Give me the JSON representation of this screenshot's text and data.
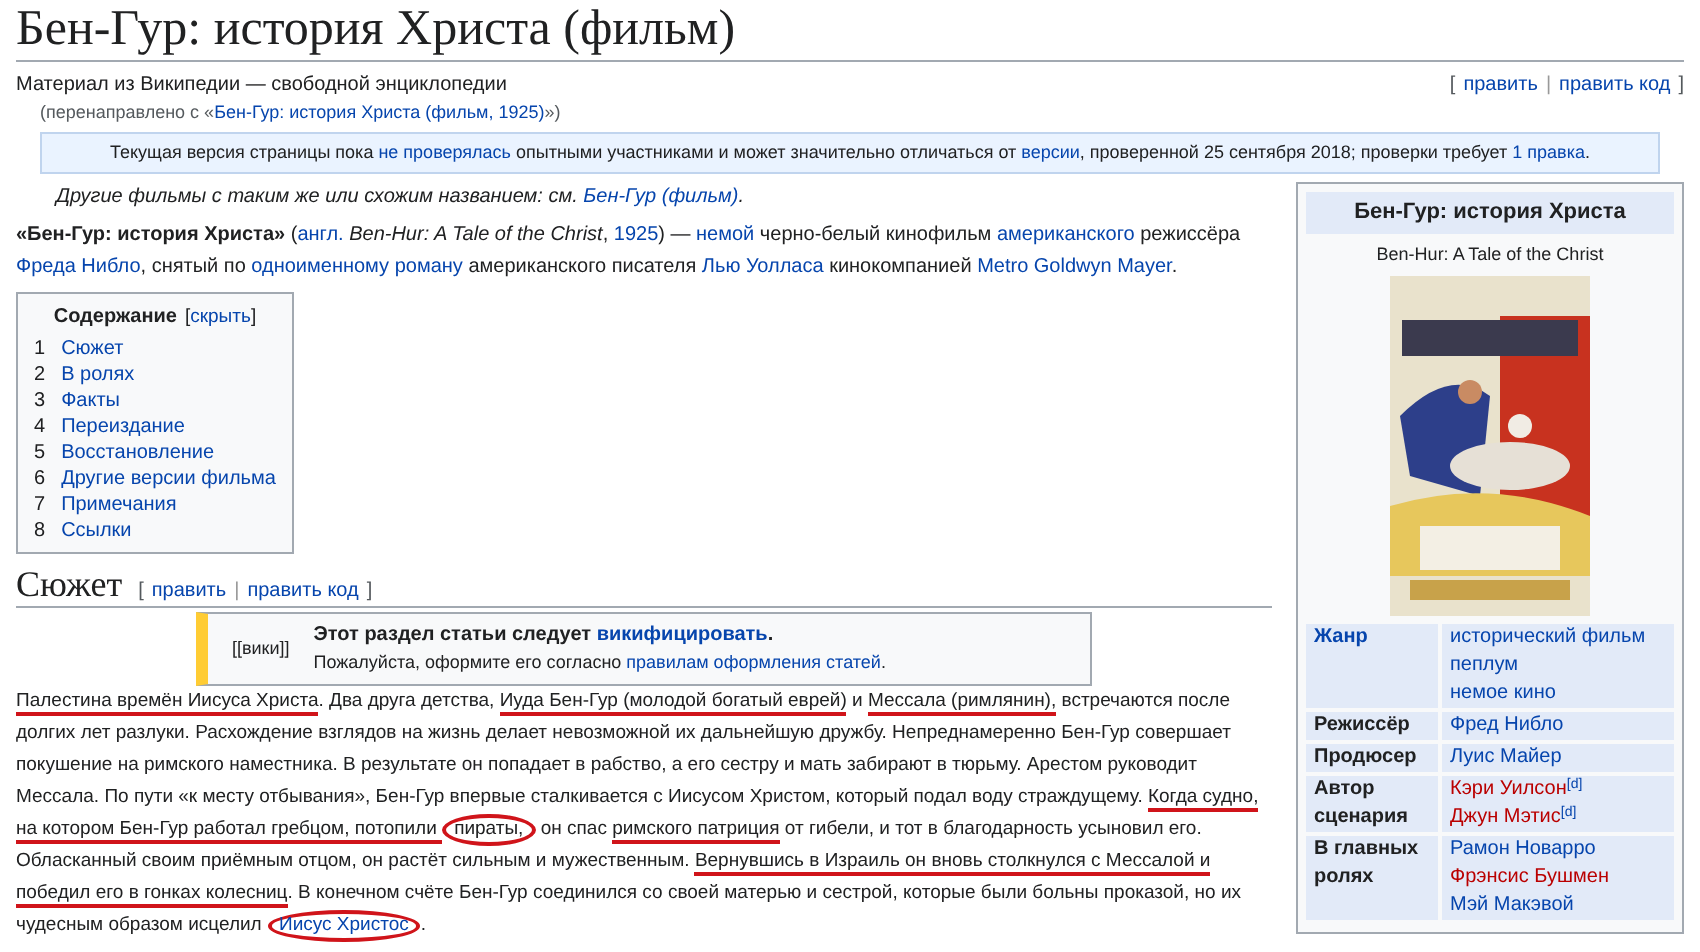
{
  "title": "Бен-Гур: история Христа (фильм)",
  "tagline": "Материал из Википедии — свободной энциклопедии",
  "edit_links": {
    "open": "[",
    "items": [
      "править",
      "править код"
    ],
    "separator": "|",
    "close": "]"
  },
  "redirect": {
    "before": "(перенаправлено с «",
    "link": "Бен-Гур: история Христа (фильм, 1925)",
    "after": "»)"
  },
  "notice": [
    {
      "text": "Текущая версия страницы пока ",
      "kind": "plain"
    },
    {
      "text": "не проверялась",
      "kind": "link"
    },
    {
      "text": " опытными участниками и может значительно отличаться от ",
      "kind": "plain"
    },
    {
      "text": "версии",
      "kind": "link"
    },
    {
      "text": ", проверенной 25 сентября 2018; проверки требует ",
      "kind": "plain"
    },
    {
      "text": "1 правка",
      "kind": "link"
    },
    {
      "text": ".",
      "kind": "plain"
    }
  ],
  "hatnote": [
    {
      "text": "Другие фильмы с таким же или схожим названием: см. ",
      "kind": "plain"
    },
    {
      "text": "Бен-Гур (фильм)",
      "kind": "link"
    },
    {
      "text": ".",
      "kind": "plain"
    }
  ],
  "intro": [
    {
      "text": "«Бен-Гур: история Христа»",
      "kind": "bold"
    },
    {
      "text": " (",
      "kind": "plain"
    },
    {
      "text": "англ.",
      "kind": "link"
    },
    {
      "text": " Ben-Hur: A Tale of the Christ",
      "kind": "italic"
    },
    {
      "text": ", ",
      "kind": "plain"
    },
    {
      "text": "1925",
      "kind": "link"
    },
    {
      "text": ") — ",
      "kind": "plain"
    },
    {
      "text": "немой",
      "kind": "link"
    },
    {
      "text": " черно-белый кинофильм ",
      "kind": "plain"
    },
    {
      "text": "американского",
      "kind": "link"
    },
    {
      "text": " режиссёра ",
      "kind": "plain"
    },
    {
      "text": "Фреда Нибло",
      "kind": "link"
    },
    {
      "text": ", снятый по ",
      "kind": "plain"
    },
    {
      "text": "одноименному роману",
      "kind": "link"
    },
    {
      "text": " американского писателя ",
      "kind": "plain"
    },
    {
      "text": "Лью Уолласа",
      "kind": "link"
    },
    {
      "text": " кинокомпанией ",
      "kind": "plain"
    },
    {
      "text": "Metro Goldwyn Mayer",
      "kind": "link"
    },
    {
      "text": ".",
      "kind": "plain"
    }
  ],
  "toc": {
    "title": "Содержание",
    "toggle_open": "[",
    "toggle": "скрыть",
    "toggle_close": "]",
    "items": [
      {
        "number": "1",
        "label": "Сюжет"
      },
      {
        "number": "2",
        "label": "В ролях"
      },
      {
        "number": "3",
        "label": "Факты"
      },
      {
        "number": "4",
        "label": "Переиздание"
      },
      {
        "number": "5",
        "label": "Восстановление"
      },
      {
        "number": "6",
        "label": "Другие версии фильма"
      },
      {
        "number": "7",
        "label": "Примечания"
      },
      {
        "number": "8",
        "label": "Ссылки"
      }
    ]
  },
  "section": {
    "heading": "Сюжет",
    "edit_links": {
      "open": "[",
      "items": [
        "править",
        "править код"
      ],
      "separator": "|",
      "close": "]"
    }
  },
  "ambox": {
    "icon": "[[вики]]",
    "title": [
      {
        "text": "Этот раздел статьи следует ",
        "kind": "plain"
      },
      {
        "text": "викифицировать",
        "kind": "link"
      },
      {
        "text": ".",
        "kind": "plain"
      }
    ],
    "body": [
      {
        "text": "Пожалуйста, оформите его согласно ",
        "kind": "plain"
      },
      {
        "text": "правилам оформления статей",
        "kind": "link"
      },
      {
        "text": ".",
        "kind": "plain"
      }
    ]
  },
  "plot": [
    {
      "text": "Палестина времён Иисуса Христа",
      "kind": "underlined"
    },
    {
      "text": ". Два друга детства, ",
      "kind": "plain"
    },
    {
      "text": "Иуда Бен-Гур (молодой богатый еврей)",
      "kind": "underlined"
    },
    {
      "text": " и ",
      "kind": "plain"
    },
    {
      "text": "Мессала (римлянин),",
      "kind": "underlined"
    },
    {
      "text": " встречаются после долгих лет разлуки. Расхождение взглядов на жизнь делает невозможной их дальнейшую дружбу. Непреднамеренно Бен-Гур совершает покушение на римского наместника. В результате он попадает в рабство, а его сестру и мать забирают в тюрьму. Арестом руководит Мессала. По пути «к месту отбывания», Бен-Гур впервые сталкивается с Иисусом Христом, который подал воду страждущему. ",
      "kind": "plain"
    },
    {
      "text": "Когда судно, на котором Бен-Гур работал гребцом, потопили ",
      "kind": "underlined"
    },
    {
      "text": "пираты,",
      "kind": "circled"
    },
    {
      "text": " он спас ",
      "kind": "plain"
    },
    {
      "text": "римского патриция",
      "kind": "underlined"
    },
    {
      "text": " от гибели, и тот в благодарность усыновил его. Обласканный своим приёмным отцом, он растёт сильным и мужественным. ",
      "kind": "plain"
    },
    {
      "text": "Вернувшись в Израиль он вновь столкнулся с Мессалой и победил его в гонках колесниц",
      "kind": "underlined"
    },
    {
      "text": ". В конечном счёте Бен-Гур соединился со своей матерью и сестрой, которые были больны проказой, но их чудесным образом исцелил ",
      "kind": "plain"
    },
    {
      "text": "Иисус Христос",
      "kind": "circled-link"
    },
    {
      "text": ".",
      "kind": "plain"
    }
  ],
  "infobox": {
    "title": "Бен-Гур: история Христа",
    "original_title": "Ben-Hur: A Tale of the Christ",
    "rows": [
      {
        "label": "Жанр",
        "label_link": true,
        "values": [
          {
            "text": "исторический фильм",
            "missing": false
          },
          {
            "text": "пеплум",
            "missing": false
          },
          {
            "text": "немое кино",
            "missing": false
          }
        ]
      },
      {
        "label": "Режиссёр",
        "label_link": false,
        "values": [
          {
            "text": "Фред Нибло",
            "missing": false
          }
        ]
      },
      {
        "label": "Продюсер",
        "label_link": false,
        "values": [
          {
            "text": "Луис Майер",
            "missing": false
          }
        ]
      },
      {
        "label": "Автор сценария",
        "label_link": false,
        "values": [
          {
            "text": "Кэри Уилсон",
            "missing": true,
            "sup": "[d]"
          },
          {
            "text": "Джун Мэтис",
            "missing": true,
            "sup": "[d]"
          }
        ]
      },
      {
        "label": "В главных ролях",
        "label_link": false,
        "values": [
          {
            "text": "Рамон Новарро",
            "missing": false
          },
          {
            "text": "Фрэнсис Бушмен",
            "missing": true
          },
          {
            "text": "Мэй Макэвой",
            "missing": false
          }
        ]
      }
    ]
  }
}
